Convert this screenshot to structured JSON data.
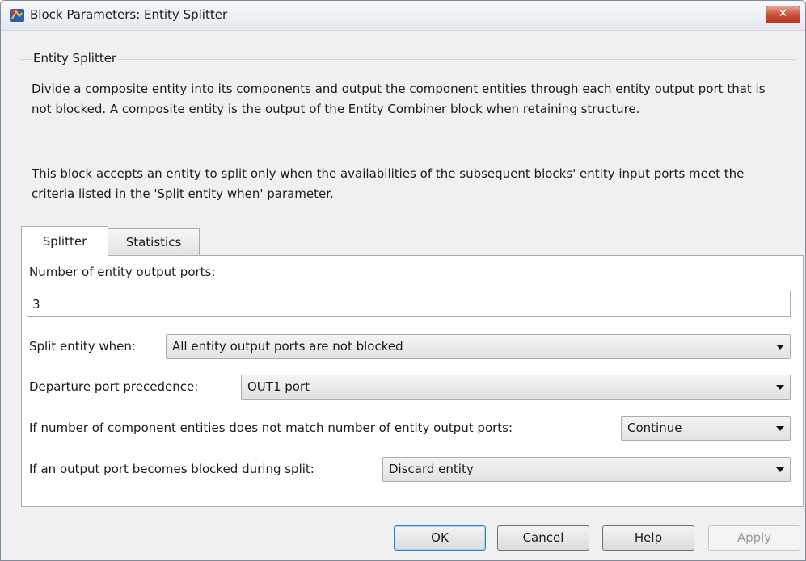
{
  "window": {
    "title": "Block Parameters: Entity Splitter",
    "close_label": "✕"
  },
  "group": {
    "label": "Entity Splitter",
    "description_1": "Divide a composite entity into its components and output the component entities through each entity output port that is not blocked. A composite entity is the output of the Entity Combiner block when retaining structure.",
    "description_2": "This block accepts an entity to split only when the availabilities of the subsequent blocks' entity input ports meet the criteria listed in the 'Split entity when' parameter."
  },
  "tabs": [
    {
      "label": "Splitter",
      "active": true
    },
    {
      "label": "Statistics",
      "active": false
    }
  ],
  "params": {
    "num_ports_label": "Number of entity output ports:",
    "num_ports_value": "3",
    "split_when_label": "Split entity when:",
    "split_when_value": "All entity output ports are not blocked",
    "precedence_label": "Departure port precedence:",
    "precedence_value": "OUT1 port",
    "mismatch_label": "If number of component entities does not match number of entity output ports:",
    "mismatch_value": "Continue",
    "blocked_label": "If an output port becomes blocked during split:",
    "blocked_value": "Discard entity"
  },
  "buttons": {
    "ok": "OK",
    "cancel": "Cancel",
    "help": "Help",
    "apply": "Apply"
  },
  "colors": {
    "close_button": "#c64a34",
    "panel_bg": "#f0f0f0",
    "default_border": "#3c7fb1"
  }
}
